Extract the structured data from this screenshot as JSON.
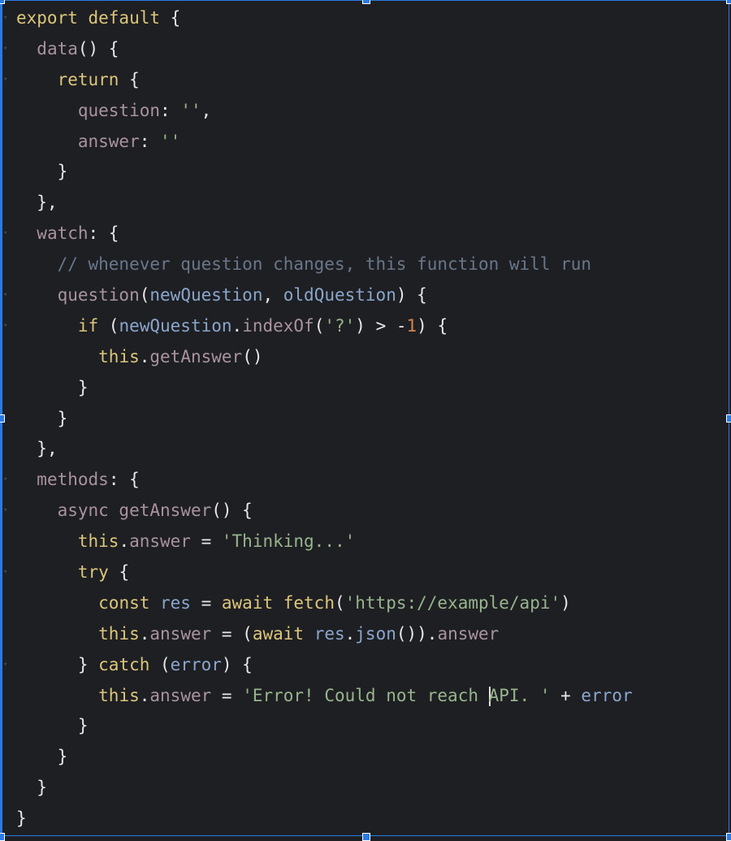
{
  "editor": {
    "language": "javascript",
    "accent_color": "#2a7be4",
    "background_color": "#1e1f23",
    "lines": [
      {
        "fold": true,
        "indent": 0,
        "tokens": [
          [
            "kw",
            "export default "
          ],
          [
            "pn",
            "{"
          ]
        ]
      },
      {
        "fold": true,
        "indent": 1,
        "tokens": [
          [
            "prop",
            "data"
          ],
          [
            "pn",
            "() {"
          ]
        ]
      },
      {
        "fold": true,
        "indent": 2,
        "tokens": [
          [
            "kw",
            "return "
          ],
          [
            "pn",
            "{"
          ]
        ]
      },
      {
        "fold": false,
        "indent": 3,
        "tokens": [
          [
            "prop",
            "question"
          ],
          [
            "pn",
            ": "
          ],
          [
            "str",
            "''"
          ],
          [
            "pn",
            ","
          ]
        ]
      },
      {
        "fold": false,
        "indent": 3,
        "tokens": [
          [
            "prop",
            "answer"
          ],
          [
            "pn",
            ": "
          ],
          [
            "str",
            "''"
          ]
        ]
      },
      {
        "fold": false,
        "indent": 2,
        "tokens": [
          [
            "pn",
            "}"
          ]
        ]
      },
      {
        "fold": false,
        "indent": 1,
        "tokens": [
          [
            "pn",
            "},"
          ]
        ]
      },
      {
        "fold": true,
        "indent": 1,
        "tokens": [
          [
            "prop",
            "watch"
          ],
          [
            "pn",
            ": {"
          ]
        ]
      },
      {
        "fold": false,
        "indent": 2,
        "tokens": [
          [
            "cm",
            "// whenever question changes, this function will run"
          ]
        ]
      },
      {
        "fold": true,
        "indent": 2,
        "tokens": [
          [
            "prop",
            "question"
          ],
          [
            "pn",
            "("
          ],
          [
            "id",
            "newQuestion"
          ],
          [
            "pn",
            ", "
          ],
          [
            "id",
            "oldQuestion"
          ],
          [
            "pn",
            ") {"
          ]
        ]
      },
      {
        "fold": true,
        "indent": 3,
        "tokens": [
          [
            "kw",
            "if "
          ],
          [
            "pn",
            "("
          ],
          [
            "id",
            "newQuestion"
          ],
          [
            "pn",
            "."
          ],
          [
            "prop",
            "indexOf"
          ],
          [
            "pn",
            "("
          ],
          [
            "str",
            "'?'"
          ],
          [
            "pn",
            ") > -"
          ],
          [
            "num",
            "1"
          ],
          [
            "pn",
            ") {"
          ]
        ]
      },
      {
        "fold": false,
        "indent": 4,
        "tokens": [
          [
            "kw",
            "this"
          ],
          [
            "pn",
            "."
          ],
          [
            "prop",
            "getAnswer"
          ],
          [
            "pn",
            "()"
          ]
        ]
      },
      {
        "fold": false,
        "indent": 3,
        "tokens": [
          [
            "pn",
            "}"
          ]
        ]
      },
      {
        "fold": false,
        "indent": 2,
        "tokens": [
          [
            "pn",
            "}"
          ]
        ]
      },
      {
        "fold": false,
        "indent": 1,
        "tokens": [
          [
            "pn",
            "},"
          ]
        ]
      },
      {
        "fold": true,
        "indent": 1,
        "tokens": [
          [
            "prop",
            "methods"
          ],
          [
            "pn",
            ": {"
          ]
        ]
      },
      {
        "fold": true,
        "indent": 2,
        "tokens": [
          [
            "prop",
            "async getAnswer"
          ],
          [
            "pn",
            "() {"
          ]
        ]
      },
      {
        "fold": false,
        "indent": 3,
        "tokens": [
          [
            "kw",
            "this"
          ],
          [
            "pn",
            "."
          ],
          [
            "prop",
            "answer"
          ],
          [
            "pn",
            " = "
          ],
          [
            "str",
            "'Thinking...'"
          ]
        ]
      },
      {
        "fold": true,
        "indent": 3,
        "tokens": [
          [
            "kw",
            "try "
          ],
          [
            "pn",
            "{"
          ]
        ]
      },
      {
        "fold": false,
        "indent": 4,
        "tokens": [
          [
            "kw",
            "const "
          ],
          [
            "id",
            "res"
          ],
          [
            "pn",
            " = "
          ],
          [
            "kw",
            "await fetch"
          ],
          [
            "pn",
            "("
          ],
          [
            "str",
            "'https://example/api'"
          ],
          [
            "pn",
            ")"
          ]
        ]
      },
      {
        "fold": false,
        "indent": 4,
        "tokens": [
          [
            "kw",
            "this"
          ],
          [
            "pn",
            "."
          ],
          [
            "prop",
            "answer"
          ],
          [
            "pn",
            " = ("
          ],
          [
            "kw",
            "await "
          ],
          [
            "id",
            "res"
          ],
          [
            "pn",
            "."
          ],
          [
            "id",
            "json"
          ],
          [
            "pn",
            "())."
          ],
          [
            "prop",
            "answer"
          ]
        ]
      },
      {
        "fold": true,
        "indent": 3,
        "tokens": [
          [
            "pn",
            "} "
          ],
          [
            "kw",
            "catch "
          ],
          [
            "pn",
            "("
          ],
          [
            "id",
            "error"
          ],
          [
            "pn",
            ") {"
          ]
        ]
      },
      {
        "fold": false,
        "indent": 4,
        "tokens": [
          [
            "kw",
            "this"
          ],
          [
            "pn",
            "."
          ],
          [
            "prop",
            "answer"
          ],
          [
            "pn",
            " = "
          ],
          [
            "str",
            "'Error! Could not reach "
          ],
          [
            "cursor",
            ""
          ],
          [
            "str",
            "API. '"
          ],
          [
            "pn",
            " + "
          ],
          [
            "id",
            "error"
          ]
        ]
      },
      {
        "fold": false,
        "indent": 3,
        "tokens": [
          [
            "pn",
            "}"
          ]
        ]
      },
      {
        "fold": false,
        "indent": 2,
        "tokens": [
          [
            "pn",
            "}"
          ]
        ]
      },
      {
        "fold": false,
        "indent": 1,
        "tokens": [
          [
            "pn",
            "}"
          ]
        ]
      },
      {
        "fold": false,
        "indent": 0,
        "tokens": [
          [
            "pn",
            "}"
          ]
        ]
      }
    ]
  }
}
